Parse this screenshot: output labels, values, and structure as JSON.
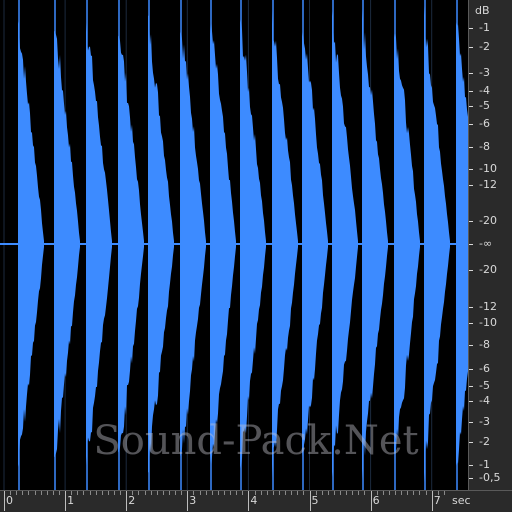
{
  "colors": {
    "waveform": "#3d8bff",
    "background": "#000000",
    "ruler_bg": "#2a2a2a",
    "ruler_text": "#d8d8d8"
  },
  "db_ruler": {
    "unit": "dB",
    "labels": [
      "-1",
      "-2",
      "-3",
      "-4",
      "-5",
      "-6",
      "-8",
      "-10",
      "-12",
      "-20",
      "-∞",
      "-20",
      "-12",
      "-10",
      "-8",
      "-6",
      "-5",
      "-4",
      "-3",
      "-2",
      "-1",
      "-0,5"
    ]
  },
  "time_ruler": {
    "unit": "sec",
    "labels": [
      "0",
      "1",
      "2",
      "3",
      "4",
      "5",
      "6",
      "7"
    ]
  },
  "watermark": "Sound-Pack.Net"
}
